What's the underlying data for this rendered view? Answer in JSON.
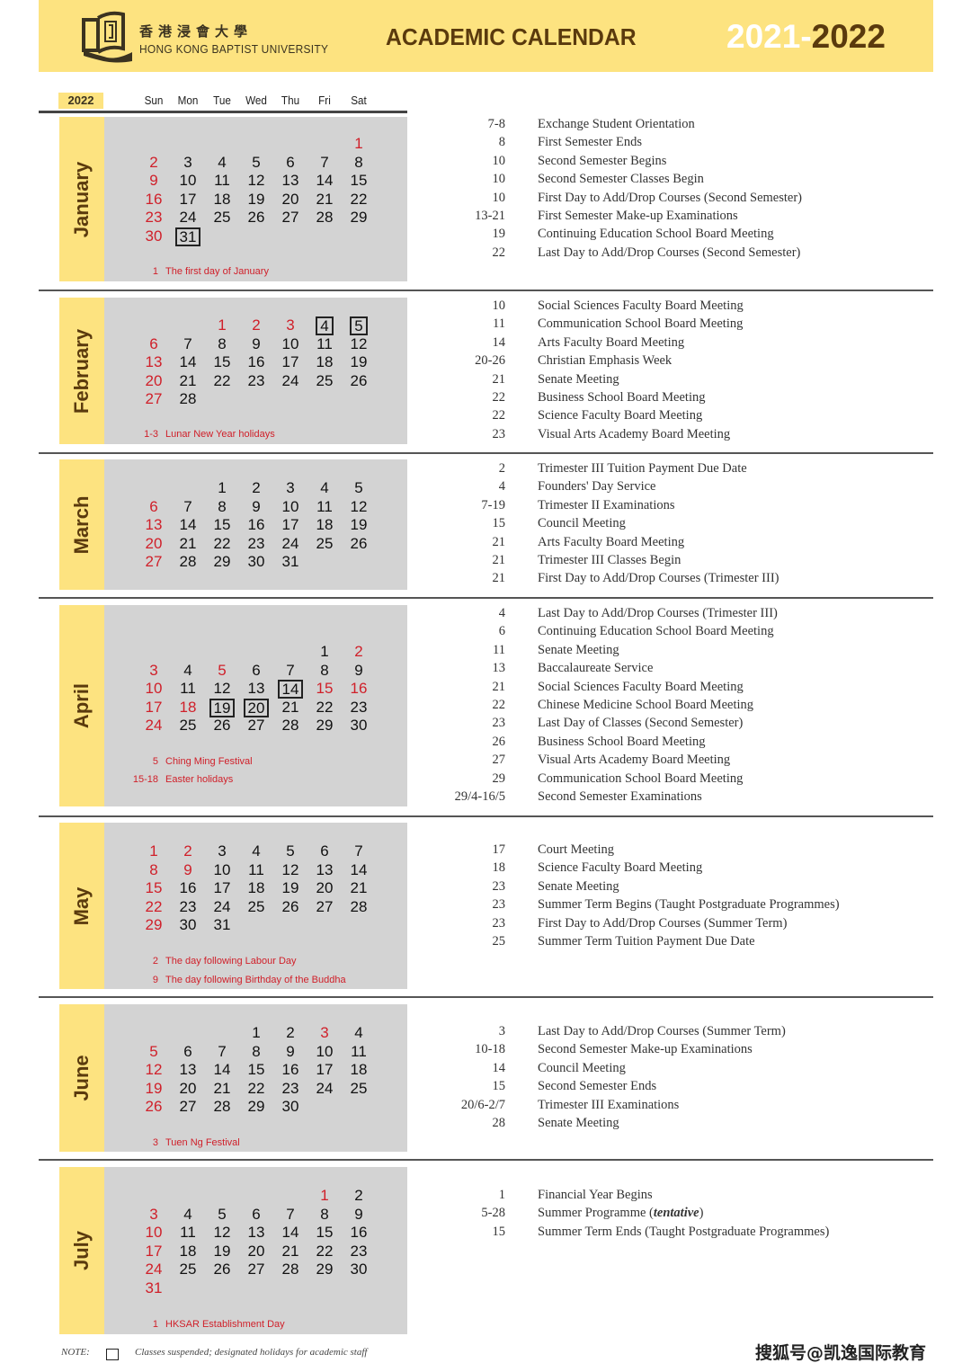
{
  "header": {
    "university_cn": "香港浸會大學",
    "university_en": "HONG KONG BAPTIST UNIVERSITY",
    "title": "ACADEMIC CALENDAR",
    "year_start": "2021",
    "year_dash": "-",
    "year_end": "2022",
    "logo_icon": "open-book-logo-icon"
  },
  "colors": {
    "accent_yellow": "#fde380",
    "brown": "#5a3a0d",
    "holiday_red": "#d0202a",
    "panel_gray": "#d3d3d3"
  },
  "calendar_header": {
    "year": "2022",
    "weekdays": [
      "Sun",
      "Mon",
      "Tue",
      "Wed",
      "Thu",
      "Fri",
      "Sat"
    ]
  },
  "months": [
    {
      "name": "January",
      "first_weekday": 6,
      "days": 31,
      "red_days": [
        1,
        2,
        9,
        16,
        23,
        30
      ],
      "boxed_days": [
        31
      ],
      "holidays": [
        {
          "date": "1",
          "label": "The first day of January"
        }
      ],
      "events": [
        {
          "date": "7-8",
          "text": "Exchange Student Orientation"
        },
        {
          "date": "8",
          "text": "First Semester Ends"
        },
        {
          "date": "10",
          "text": "Second Semester Begins"
        },
        {
          "date": "10",
          "text": "Second Semester Classes Begin"
        },
        {
          "date": "10",
          "text": "First Day to Add/Drop Courses (Second Semester)"
        },
        {
          "date": "13-21",
          "text": "First Semester Make-up Examinations"
        },
        {
          "date": "19",
          "text": "Continuing Education School Board Meeting"
        },
        {
          "date": "22",
          "text": "Last Day to Add/Drop Courses (Second Semester)"
        }
      ]
    },
    {
      "name": "February",
      "first_weekday": 2,
      "days": 28,
      "red_days": [
        1,
        2,
        3,
        6,
        13,
        20,
        27
      ],
      "boxed_days": [
        4,
        5
      ],
      "holidays": [
        {
          "date": "1-3",
          "label": "Lunar New Year holidays"
        }
      ],
      "events": [
        {
          "date": "10",
          "text": "Social Sciences Faculty Board Meeting"
        },
        {
          "date": "11",
          "text": "Communication School Board Meeting"
        },
        {
          "date": "14",
          "text": "Arts Faculty Board Meeting"
        },
        {
          "date": "20-26",
          "text": "Christian Emphasis Week"
        },
        {
          "date": "21",
          "text": "Senate Meeting"
        },
        {
          "date": "22",
          "text": "Business School Board Meeting"
        },
        {
          "date": "22",
          "text": "Science Faculty Board Meeting"
        },
        {
          "date": "23",
          "text": "Visual Arts Academy Board Meeting"
        }
      ]
    },
    {
      "name": "March",
      "first_weekday": 2,
      "days": 31,
      "red_days": [
        6,
        13,
        20,
        27
      ],
      "boxed_days": [],
      "holidays": [],
      "events": [
        {
          "date": "2",
          "text": "Trimester III Tuition Payment Due Date"
        },
        {
          "date": "4",
          "text": "Founders' Day Service"
        },
        {
          "date": "7-19",
          "text": "Trimester II Examinations"
        },
        {
          "date": "15",
          "text": "Council Meeting"
        },
        {
          "date": "21",
          "text": "Arts Faculty Board Meeting"
        },
        {
          "date": "21",
          "text": "Trimester III Classes Begin"
        },
        {
          "date": "21",
          "text": "First Day to Add/Drop Courses (Trimester III)"
        }
      ]
    },
    {
      "name": "April",
      "first_weekday": 5,
      "days": 30,
      "red_days": [
        2,
        3,
        5,
        10,
        15,
        16,
        17,
        18,
        24
      ],
      "boxed_days": [
        14,
        19,
        20
      ],
      "holidays": [
        {
          "date": "5",
          "label": "Ching Ming Festival"
        },
        {
          "date": "15-18",
          "label": "Easter holidays"
        }
      ],
      "events": [
        {
          "date": "4",
          "text": "Last Day to Add/Drop Courses (Trimester III)"
        },
        {
          "date": "6",
          "text": "Continuing Education School Board Meeting"
        },
        {
          "date": "11",
          "text": "Senate Meeting"
        },
        {
          "date": "13",
          "text": "Baccalaureate Service"
        },
        {
          "date": "21",
          "text": "Social Sciences Faculty Board Meeting"
        },
        {
          "date": "22",
          "text": "Chinese Medicine School Board Meeting"
        },
        {
          "date": "23",
          "text": "Last Day of Classes (Second Semester)"
        },
        {
          "date": "26",
          "text": "Business School Board Meeting"
        },
        {
          "date": "27",
          "text": "Visual Arts Academy Board Meeting"
        },
        {
          "date": "29",
          "text": "Communication School Board Meeting"
        },
        {
          "date": "29/4-16/5",
          "text": "Second Semester Examinations"
        }
      ]
    },
    {
      "name": "May",
      "first_weekday": 0,
      "days": 31,
      "red_days": [
        1,
        2,
        8,
        9,
        15,
        22,
        29
      ],
      "boxed_days": [],
      "holidays": [
        {
          "date": "2",
          "label": "The day following Labour Day"
        },
        {
          "date": "9",
          "label": "The day following Birthday of the Buddha"
        }
      ],
      "events": [
        {
          "date": "17",
          "text": "Court Meeting"
        },
        {
          "date": "18",
          "text": "Science Faculty Board Meeting"
        },
        {
          "date": "23",
          "text": "Senate Meeting"
        },
        {
          "date": "23",
          "text": "Summer Term Begins (Taught Postgraduate Programmes)"
        },
        {
          "date": "23",
          "text": "First Day to Add/Drop Courses (Summer Term)"
        },
        {
          "date": "25",
          "text": "Summer Term Tuition Payment Due Date"
        }
      ]
    },
    {
      "name": "June",
      "first_weekday": 3,
      "days": 30,
      "red_days": [
        3,
        5,
        12,
        19,
        26
      ],
      "boxed_days": [],
      "holidays": [
        {
          "date": "3",
          "label": "Tuen Ng Festival"
        }
      ],
      "events": [
        {
          "date": "3",
          "text": "Last Day to Add/Drop Courses (Summer Term)"
        },
        {
          "date": "10-18",
          "text": "Second Semester Make-up Examinations"
        },
        {
          "date": "14",
          "text": "Council Meeting"
        },
        {
          "date": "15",
          "text": "Second Semester Ends"
        },
        {
          "date": "20/6-2/7",
          "text": "Trimester III Examinations"
        },
        {
          "date": "28",
          "text": "Senate Meeting"
        }
      ]
    },
    {
      "name": "July",
      "first_weekday": 5,
      "days": 31,
      "red_days": [
        1,
        3,
        10,
        17,
        24,
        31
      ],
      "boxed_days": [],
      "holidays": [
        {
          "date": "1",
          "label": "HKSAR Establishment Day"
        }
      ],
      "events": [
        {
          "date": "1",
          "text": "Financial Year Begins"
        },
        {
          "date": "5-28",
          "text": "Summer Programme (",
          "italic": "tentative",
          "suffix": ")"
        },
        {
          "date": "15",
          "text": "Summer Term Ends (Taught Postgraduate Programmes)"
        }
      ]
    }
  ],
  "note": {
    "label": "NOTE:",
    "legend_icon": "boxed-date-legend-icon",
    "text": "Classes suspended; designated holidays for academic staff"
  },
  "watermark": "搜狐号@凯逸国际教育"
}
